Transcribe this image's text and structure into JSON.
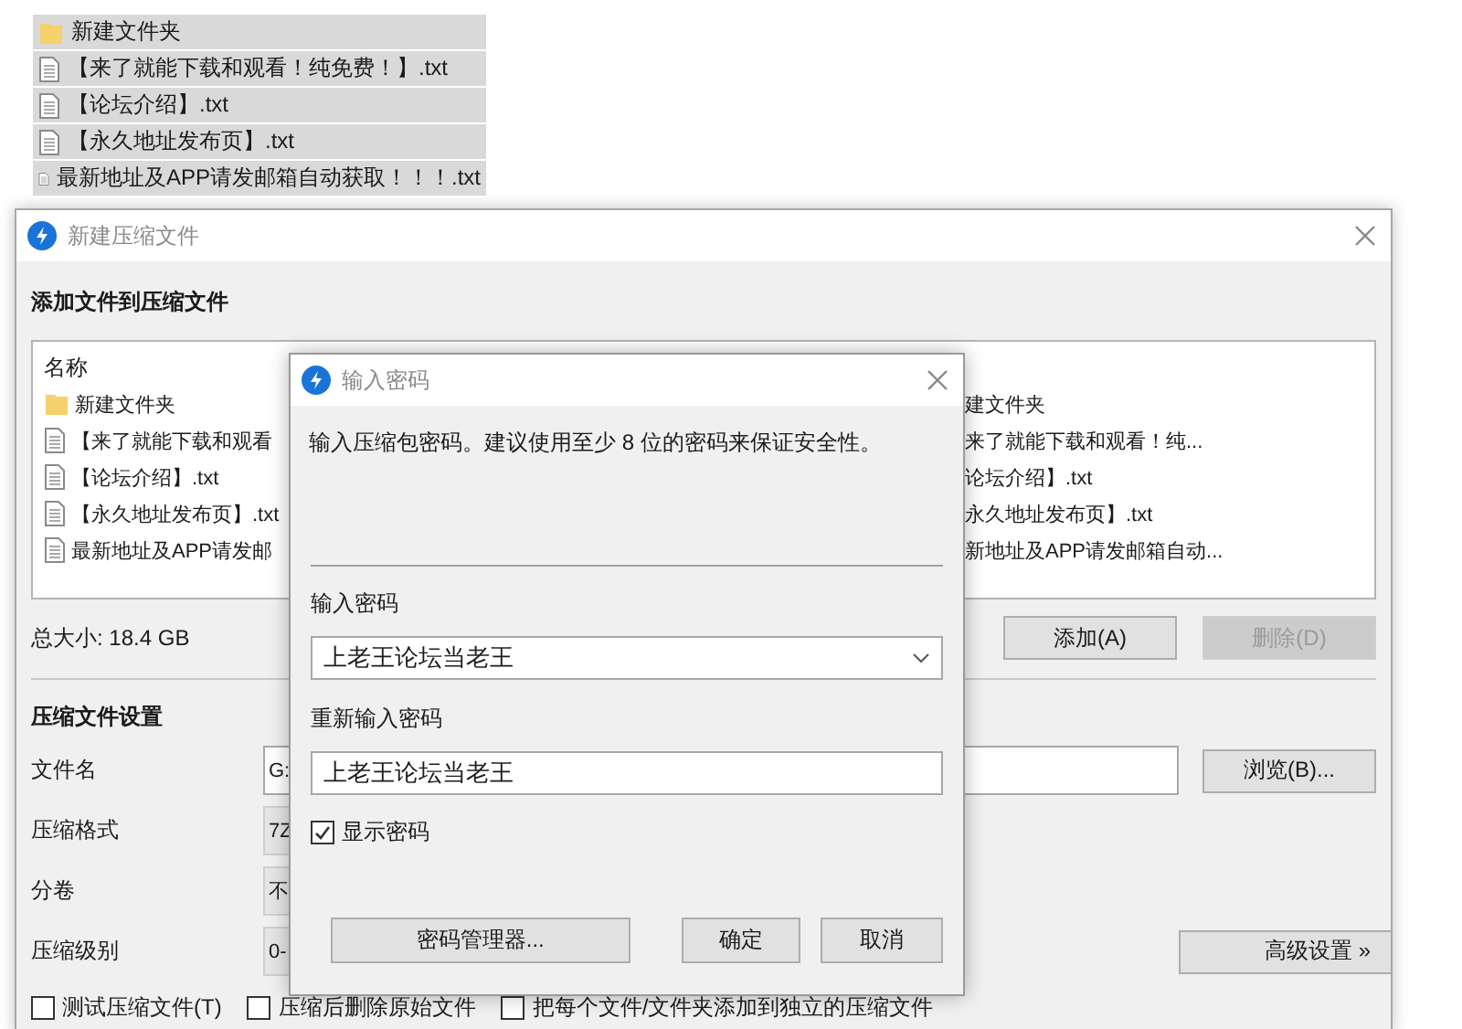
{
  "desktop_files": [
    {
      "kind": "folder",
      "name": "新建文件夹"
    },
    {
      "kind": "file",
      "name": "【来了就能下载和观看！纯免费！】.txt"
    },
    {
      "kind": "file",
      "name": "【论坛介绍】.txt"
    },
    {
      "kind": "file",
      "name": "【永久地址发布页】.txt"
    },
    {
      "kind": "file",
      "name": "最新地址及APP请发邮箱自动获取！！！.txt"
    }
  ],
  "main_window": {
    "title": "新建压缩文件",
    "section_title": "添加文件到压缩文件",
    "list_header": "名称",
    "files": [
      {
        "kind": "folder",
        "name": "新建文件夹",
        "path": "建文件夹"
      },
      {
        "kind": "file",
        "name": "【来了就能下载和观看",
        "path": "来了就能下载和观看！纯..."
      },
      {
        "kind": "file",
        "name": "【论坛介绍】.txt",
        "path": "论坛介绍】.txt"
      },
      {
        "kind": "file",
        "name": "【永久地址发布页】.txt",
        "path": "永久地址发布页】.txt"
      },
      {
        "kind": "file",
        "name": "最新地址及APP请发邮",
        "path": "新地址及APP请发邮箱自动..."
      }
    ],
    "total_size": "总大小: 18.4 GB",
    "list_buttons": [
      {
        "label": "添加(A)",
        "disabled": false
      },
      {
        "label": "删除(D)",
        "disabled": true
      }
    ],
    "settings_title": "压缩文件设置",
    "settings": [
      {
        "kind": "input",
        "label": "文件名",
        "value": "G:"
      },
      {
        "kind": "select",
        "label": "压缩格式",
        "value": "7Z"
      },
      {
        "kind": "select",
        "label": "分卷",
        "value": "不"
      },
      {
        "kind": "select",
        "label": "压缩级别",
        "value": "0-"
      }
    ],
    "browse_button": "浏览(B)...",
    "advanced_button": "高级设置 »",
    "options": [
      {
        "label": "测试压缩文件(T)",
        "checked": false
      },
      {
        "label": "压缩后删除原始文件",
        "checked": false
      },
      {
        "label": "把每个文件/文件夹添加到独立的压缩文件",
        "checked": false
      }
    ]
  },
  "password_dialog": {
    "title": "输入密码",
    "hint": "输入压缩包密码。建议使用至少 8 位的密码来保证安全性。",
    "password_label": "输入密码",
    "password": "上老王论坛当老王",
    "confirm_label": "重新输入密码",
    "confirm": "上老王论坛当老王",
    "show_password": {
      "label": "显示密码",
      "checked": true
    },
    "buttons": [
      "密码管理器...",
      "确定",
      "取消"
    ]
  }
}
